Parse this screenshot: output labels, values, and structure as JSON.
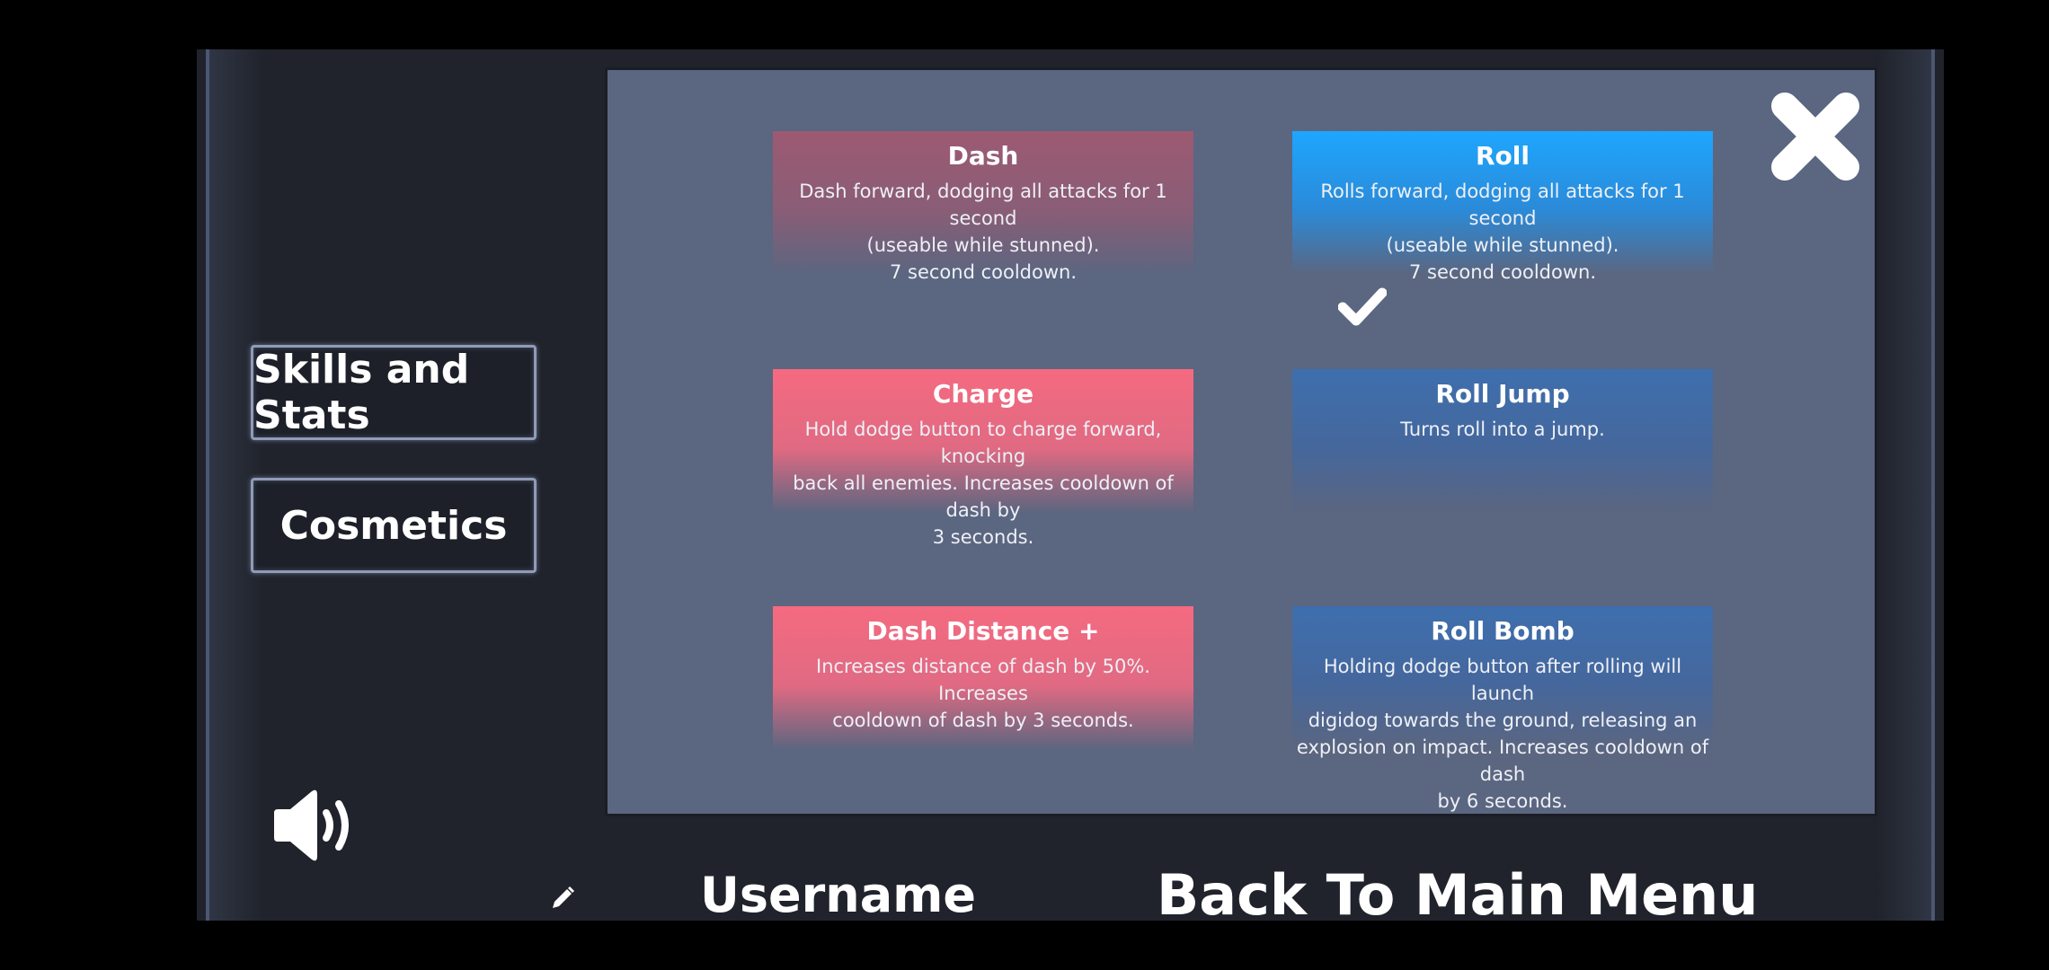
{
  "sidebar": {
    "skills_label": "Skills and Stats",
    "cosmetics_label": "Cosmetics"
  },
  "skills": [
    {
      "title": "Dash",
      "desc_lines": [
        "Dash forward, dodging all attacks for 1 second",
        "(useable while stunned).",
        "7 second cooldown."
      ],
      "selected": true
    },
    {
      "title": "Roll",
      "desc_lines": [
        "Rolls forward, dodging all attacks for 1 second",
        "(useable while stunned).",
        "7 second cooldown."
      ],
      "selected": false
    },
    {
      "title": "Charge",
      "desc_lines": [
        "Hold dodge button to charge forward, knocking",
        "back all enemies. Increases cooldown of dash by",
        "3 seconds."
      ],
      "selected": false
    },
    {
      "title": "Roll Jump",
      "desc_lines": [
        "Turns roll into a jump."
      ],
      "selected": false
    },
    {
      "title": "Dash Distance +",
      "desc_lines": [
        "Increases distance of dash by 50%. Increases",
        "cooldown of dash by 3 seconds."
      ],
      "selected": false
    },
    {
      "title": "Roll Bomb",
      "desc_lines": [
        "Holding dodge button after rolling will launch",
        "digidog towards the ground, releasing an",
        "explosion on impact. Increases cooldown of dash",
        "by 6 seconds."
      ],
      "selected": false
    }
  ],
  "footer": {
    "username": "Username",
    "back_label": "Back To Main Menu"
  },
  "icons": {
    "close": "close-icon",
    "check": "checkmark-icon",
    "sound": "speaker-icon",
    "edit": "pencil-icon"
  },
  "colors": {
    "panel": "#5b6680",
    "dash_card": "#9c5a72",
    "pink_card": "#f56a80",
    "roll_card": "#1ea6ff",
    "blue_card": "#3e6fae"
  }
}
